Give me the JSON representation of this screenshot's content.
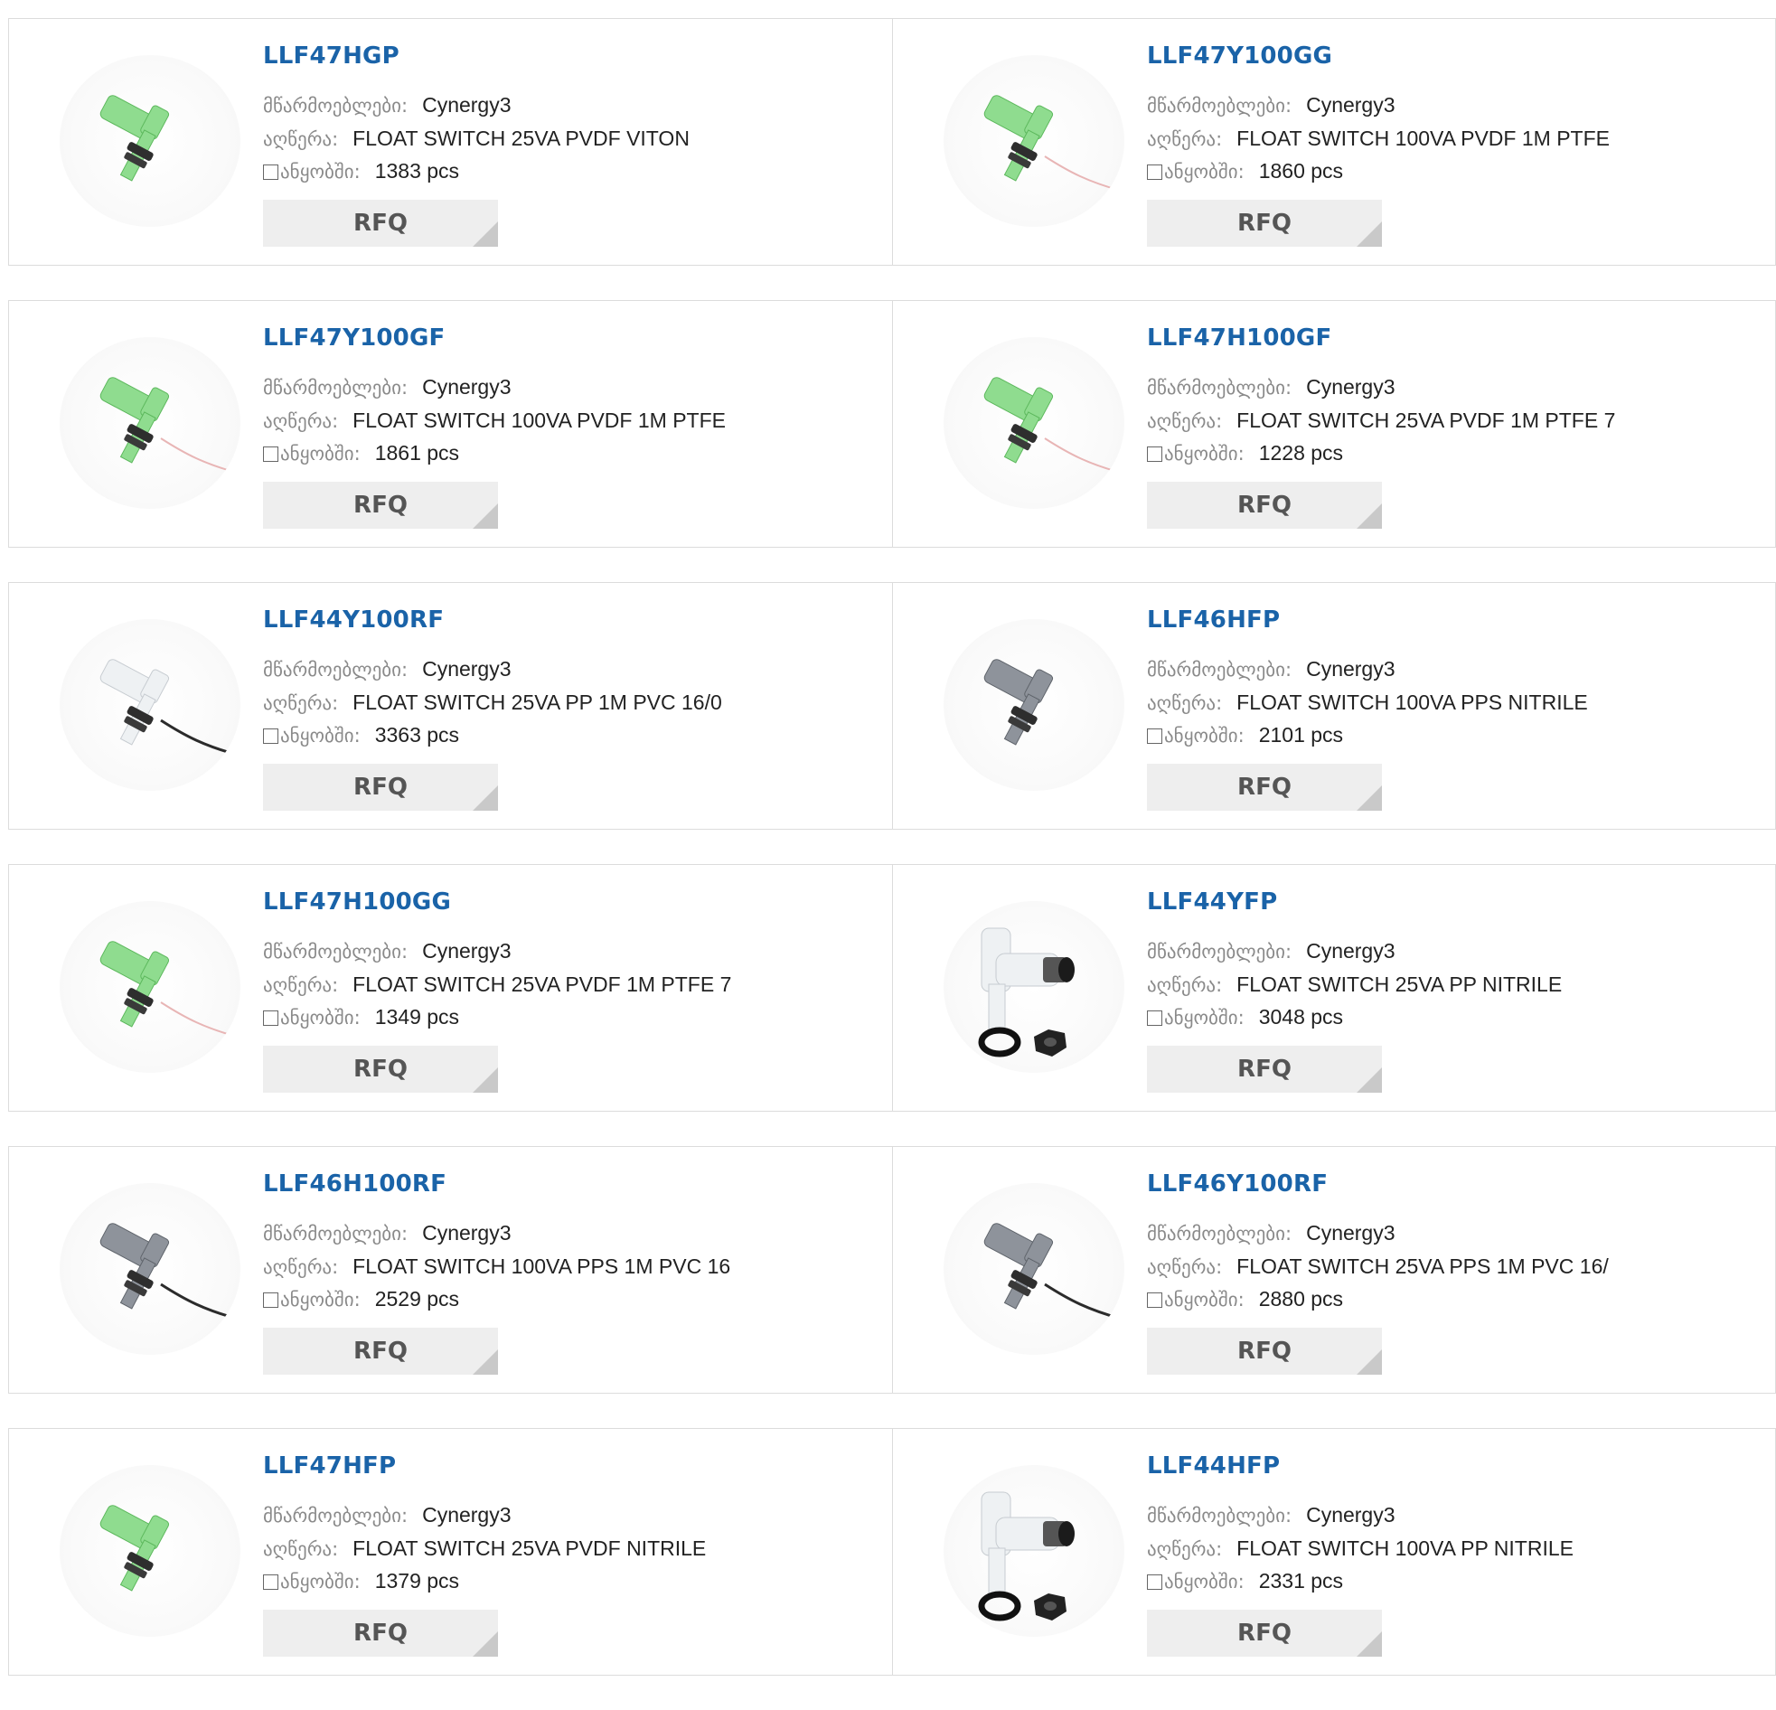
{
  "labels": {
    "manufacturer": "მწარმოებლები:",
    "description": "აღწერა:",
    "stock": "ანყობში:",
    "rfq": "RFQ"
  },
  "colors": {
    "part_link": "#1a63a8",
    "button_bg": "#eeeeee"
  },
  "products": [
    {
      "part": "LLF47HGP",
      "manufacturer": "Cynergy3",
      "description": "FLOAT SWITCH 25VA PVDF VITON",
      "stock": "1383 pcs",
      "image": "green-float-switch"
    },
    {
      "part": "LLF47Y100GG",
      "manufacturer": "Cynergy3",
      "description": "FLOAT SWITCH 100VA PVDF 1M PTFE",
      "stock": "1860 pcs",
      "image": "green-float-switch-wire"
    },
    {
      "part": "LLF47Y100GF",
      "manufacturer": "Cynergy3",
      "description": "FLOAT SWITCH 100VA PVDF 1M PTFE",
      "stock": "1861 pcs",
      "image": "green-float-switch-wire"
    },
    {
      "part": "LLF47H100GF",
      "manufacturer": "Cynergy3",
      "description": "FLOAT SWITCH 25VA PVDF 1M PTFE 7",
      "stock": "1228 pcs",
      "image": "green-float-switch-wire"
    },
    {
      "part": "LLF44Y100RF",
      "manufacturer": "Cynergy3",
      "description": "FLOAT SWITCH 25VA PP 1M PVC 16/0",
      "stock": "3363 pcs",
      "image": "clear-float-switch-cable"
    },
    {
      "part": "LLF46HFP",
      "manufacturer": "Cynergy3",
      "description": "FLOAT SWITCH 100VA PPS NITRILE",
      "stock": "2101 pcs",
      "image": "grey-float-switch"
    },
    {
      "part": "LLF47H100GG",
      "manufacturer": "Cynergy3",
      "description": "FLOAT SWITCH 25VA PVDF 1M PTFE 7",
      "stock": "1349 pcs",
      "image": "green-float-switch-wire"
    },
    {
      "part": "LLF44YFP",
      "manufacturer": "Cynergy3",
      "description": "FLOAT SWITCH 25VA PP NITRILE",
      "stock": "3048 pcs",
      "image": "clear-float-switch-nut"
    },
    {
      "part": "LLF46H100RF",
      "manufacturer": "Cynergy3",
      "description": "FLOAT SWITCH 100VA PPS 1M PVC 16",
      "stock": "2529 pcs",
      "image": "grey-float-switch-cable"
    },
    {
      "part": "LLF46Y100RF",
      "manufacturer": "Cynergy3",
      "description": "FLOAT SWITCH 25VA PPS 1M PVC 16/",
      "stock": "2880 pcs",
      "image": "grey-float-switch-cable"
    },
    {
      "part": "LLF47HFP",
      "manufacturer": "Cynergy3",
      "description": "FLOAT SWITCH 25VA PVDF NITRILE",
      "stock": "1379 pcs",
      "image": "green-float-switch"
    },
    {
      "part": "LLF44HFP",
      "manufacturer": "Cynergy3",
      "description": "FLOAT SWITCH 100VA PP NITRILE",
      "stock": "2331 pcs",
      "image": "clear-float-switch-nut"
    }
  ]
}
